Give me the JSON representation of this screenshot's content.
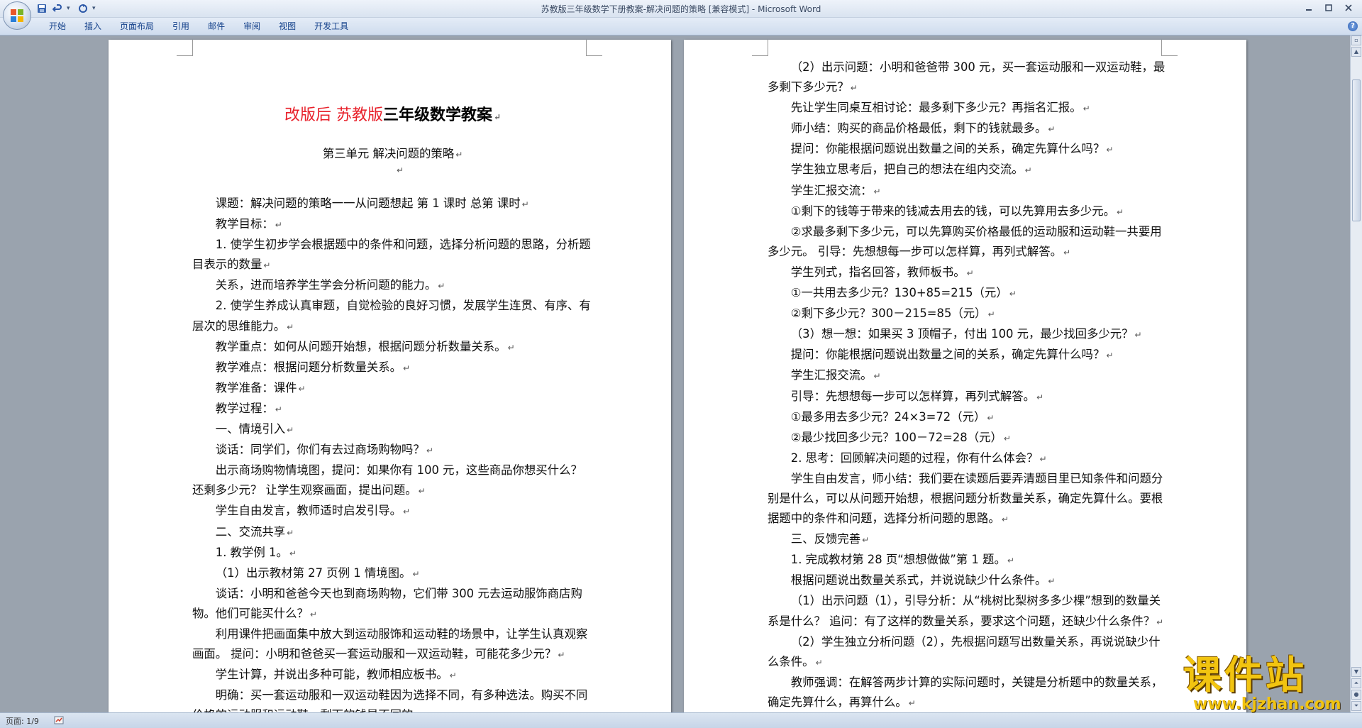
{
  "window": {
    "title": "苏教版三年级数学下册教案-解决问题的策略 [兼容模式] - ",
    "app_name": "Microsoft Word"
  },
  "quick_access": {
    "items": [
      "save-icon",
      "undo-icon",
      "redo-icon"
    ]
  },
  "ribbon": {
    "tabs": [
      "开始",
      "插入",
      "页面布局",
      "引用",
      "邮件",
      "审阅",
      "视图",
      "开发工具"
    ]
  },
  "page1": {
    "title_red": "改版后  苏教版",
    "title_black": "三年级数学教案",
    "subtitle": "第三单元  解决问题的策略",
    "paragraphs": [
      "课题：解决问题的策略一一从问题想起  第  1  课时  总第  课时",
      "教学目标：",
      "1. 使学生初步学会根据题中的条件和问题，选择分析问题的思路，分析题目表示的数量",
      "关系，进而培养学生学会分析问题的能力。",
      "2. 使学生养成认真审题，自觉检验的良好习惯，发展学生连贯、有序、有层次的思维能力。",
      "教学重点：如何从问题开始想，根据问题分析数量关系。",
      "教学难点：根据问题分析数量关系。",
      "教学准备：课件",
      "教学过程：",
      "一、情境引入",
      "谈话：同学们，你们有去过商场购物吗？",
      "出示商场购物情境图，提问：如果你有 100 元，这些商品你想买什么？还剩多少元？  让学生观察画面，提出问题。",
      "学生自由发言，教师适时启发引导。",
      "二、交流共享",
      "1. 教学例 1。",
      "（1）出示教材第 27 页例 1 情境图。",
      "谈话：小明和爸爸今天也到商场购物，它们带 300 元去运动服饰商店购物。他们可能买什么？",
      "利用课件把画面集中放大到运动服饰和运动鞋的场景中，让学生认真观察画面。  提问：小明和爸爸买一套运动服和一双运动鞋，可能花多少元？",
      "学生计算，并说出多种可能，教师相应板书。",
      "明确：买一套运动服和一双运动鞋因为选择不同，有多种选法。购买不同价格的运动服和运动鞋，剩下的钱是不同的。"
    ]
  },
  "page2": {
    "paragraphs": [
      "（2）出示问题：小明和爸爸带 300 元，买一套运动服和一双运动鞋，最多剩下多少元？",
      "先让学生同桌互相讨论：最多剩下多少元？再指名汇报。",
      "师小结：购买的商品价格最低，剩下的钱就最多。",
      "提问：你能根据问题说出数量之间的关系，确定先算什么吗？",
      "学生独立思考后，把自己的想法在组内交流。",
      "学生汇报交流：",
      "①剩下的钱等于带来的钱减去用去的钱，可以先算用去多少元。",
      "②求最多剩下多少元，可以先算购买价格最低的运动服和运动鞋一共要用多少元。  引导：先想想每一步可以怎样算，再列式解答。",
      "学生列式，指名回答，教师板书。",
      "①一共用去多少元？130+85=215（元）",
      "②剩下多少元？300－215=85（元）",
      "（3）想一想：如果买 3 顶帽子，付出 100 元，最少找回多少元？",
      "提问：你能根据问题说出数量之间的关系，确定先算什么吗？",
      "学生汇报交流。",
      "引导：先想想每一步可以怎样算，再列式解答。",
      "①最多用去多少元？24×3=72（元）",
      "②最少找回多少元？100－72=28（元）",
      "2. 思考：回顾解决问题的过程，你有什么体会？",
      "学生自由发言，师小结：我们要在读题后要弄清题目里已知条件和问题分别是什么，可以从问题开始想，根据问题分析数量关系，确定先算什么。要根据题中的条件和问题，选择分析问题的思路。",
      "三、反馈完善",
      "1. 完成教材第 28 页“想想做做”第 1 题。",
      "根据问题说出数量关系式，并说说缺少什么条件。",
      "（1）出示问题（1），引导分析：从“桃树比梨树多多少棵”想到的数量关系是什么？  追问：有了这样的数量关系，要求这个问题，还缺少什么条件？",
      "（2）学生独立分析问题（2），先根据问题写出数量关系，再说说缺少什么条件。",
      "教师强调：在解答两步计算的实际问题时，关键是分析题中的数量关系，确定先算什么，再算什么。"
    ]
  },
  "status": {
    "page_info": "页面: 1/9"
  },
  "watermark": {
    "main": "课件站",
    "url": "www.kjzhan.com"
  },
  "colors": {
    "title_red": "#e8202a",
    "ribbon_text": "#15428b",
    "watermark_gold": "#f2c410",
    "canvas_gray": "#9aa3ae"
  }
}
